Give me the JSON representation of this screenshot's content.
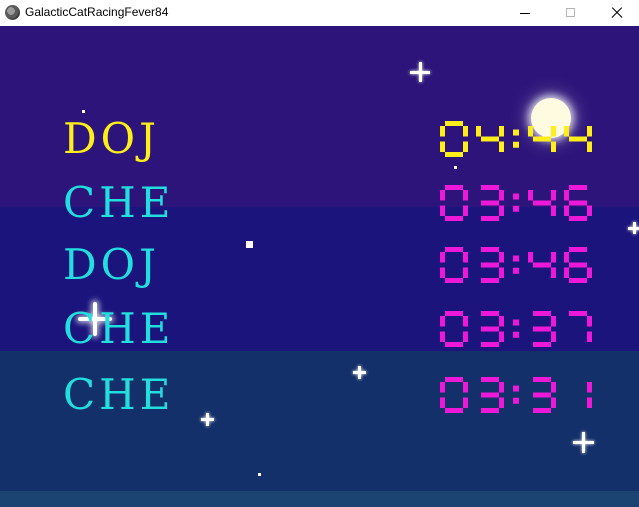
{
  "window": {
    "title": "GalacticCatRacingFever84",
    "icon": "cat-app-icon",
    "controls": [
      "minimize-icon",
      "maximize-icon",
      "close-icon"
    ]
  },
  "colors": {
    "leader": "#ffee1a",
    "name": "#22dede",
    "time": "#ee18d8"
  },
  "leaderboard": {
    "entries": [
      {
        "name": "DOJ",
        "time": "04:44",
        "highlight": true
      },
      {
        "name": "CHE",
        "time": "03:46",
        "highlight": false
      },
      {
        "name": "DOJ",
        "time": "03:46",
        "highlight": false
      },
      {
        "name": "CHE",
        "time": "03:37",
        "highlight": false
      },
      {
        "name": "CHE",
        "time": "03:31",
        "highlight": false
      }
    ]
  }
}
